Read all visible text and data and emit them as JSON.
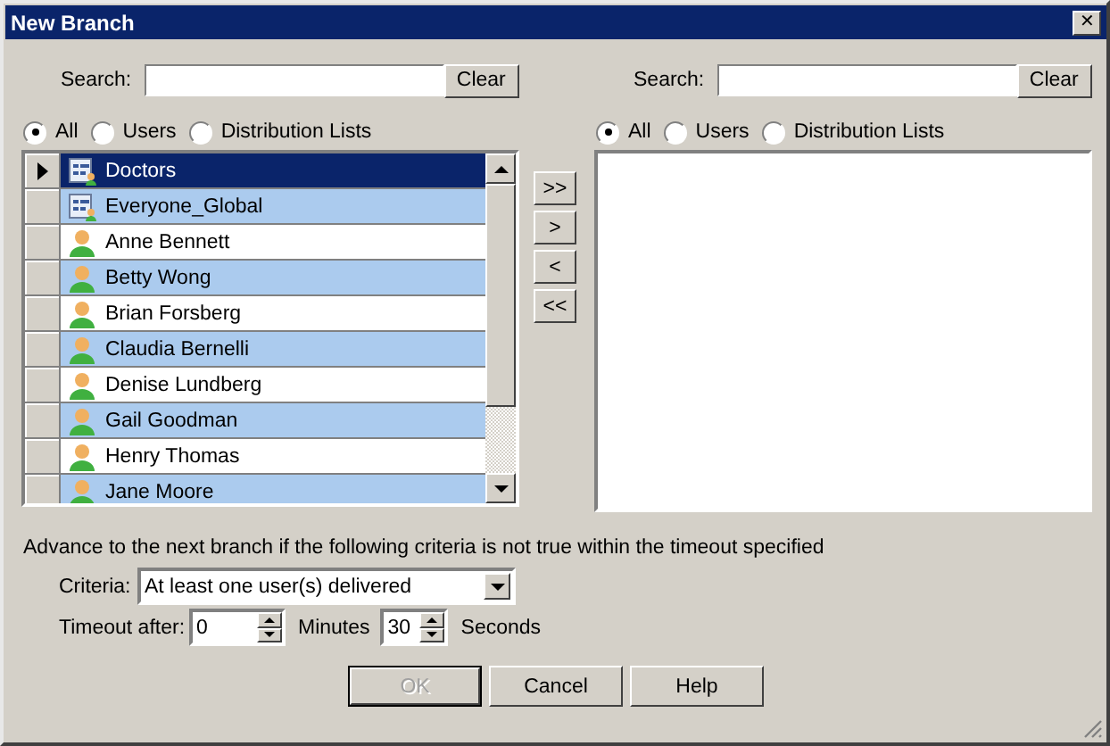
{
  "window": {
    "title": "New Branch",
    "close": "✕"
  },
  "left": {
    "search_label": "Search:",
    "clear": "Clear",
    "filters": [
      {
        "label": "All",
        "selected": true
      },
      {
        "label": "Users",
        "selected": false
      },
      {
        "label": "Distribution Lists",
        "selected": false
      }
    ],
    "rows": [
      {
        "kind": "group",
        "name": "Doctors",
        "selected": true
      },
      {
        "kind": "group",
        "name": "Everyone_Global",
        "selected": false
      },
      {
        "kind": "user",
        "name": "Anne Bennett",
        "selected": false
      },
      {
        "kind": "user",
        "name": "Betty Wong",
        "selected": false
      },
      {
        "kind": "user",
        "name": "Brian Forsberg",
        "selected": false
      },
      {
        "kind": "user",
        "name": "Claudia Bernelli",
        "selected": false
      },
      {
        "kind": "user",
        "name": "Denise Lundberg",
        "selected": false
      },
      {
        "kind": "user",
        "name": "Gail Goodman",
        "selected": false
      },
      {
        "kind": "user",
        "name": "Henry Thomas",
        "selected": false
      },
      {
        "kind": "user",
        "name": "Jane Moore",
        "selected": false
      }
    ]
  },
  "move_buttons": [
    ">>",
    ">",
    "<",
    "<<"
  ],
  "right": {
    "search_label": "Search:",
    "clear": "Clear",
    "filters": [
      {
        "label": "All",
        "selected": true
      },
      {
        "label": "Users",
        "selected": false
      },
      {
        "label": "Distribution Lists",
        "selected": false
      }
    ]
  },
  "advance_text": "Advance to the next branch if the following criteria is not true within the timeout specified",
  "criteria": {
    "label": "Criteria:",
    "value": "At least one user(s) delivered"
  },
  "timeout": {
    "label": "Timeout after:",
    "minutes": "0",
    "minutes_label": "Minutes",
    "seconds": "30",
    "seconds_label": "Seconds"
  },
  "buttons": [
    {
      "label": "OK",
      "disabled": true
    },
    {
      "label": "Cancel",
      "disabled": false
    },
    {
      "label": "Help",
      "disabled": false
    }
  ]
}
